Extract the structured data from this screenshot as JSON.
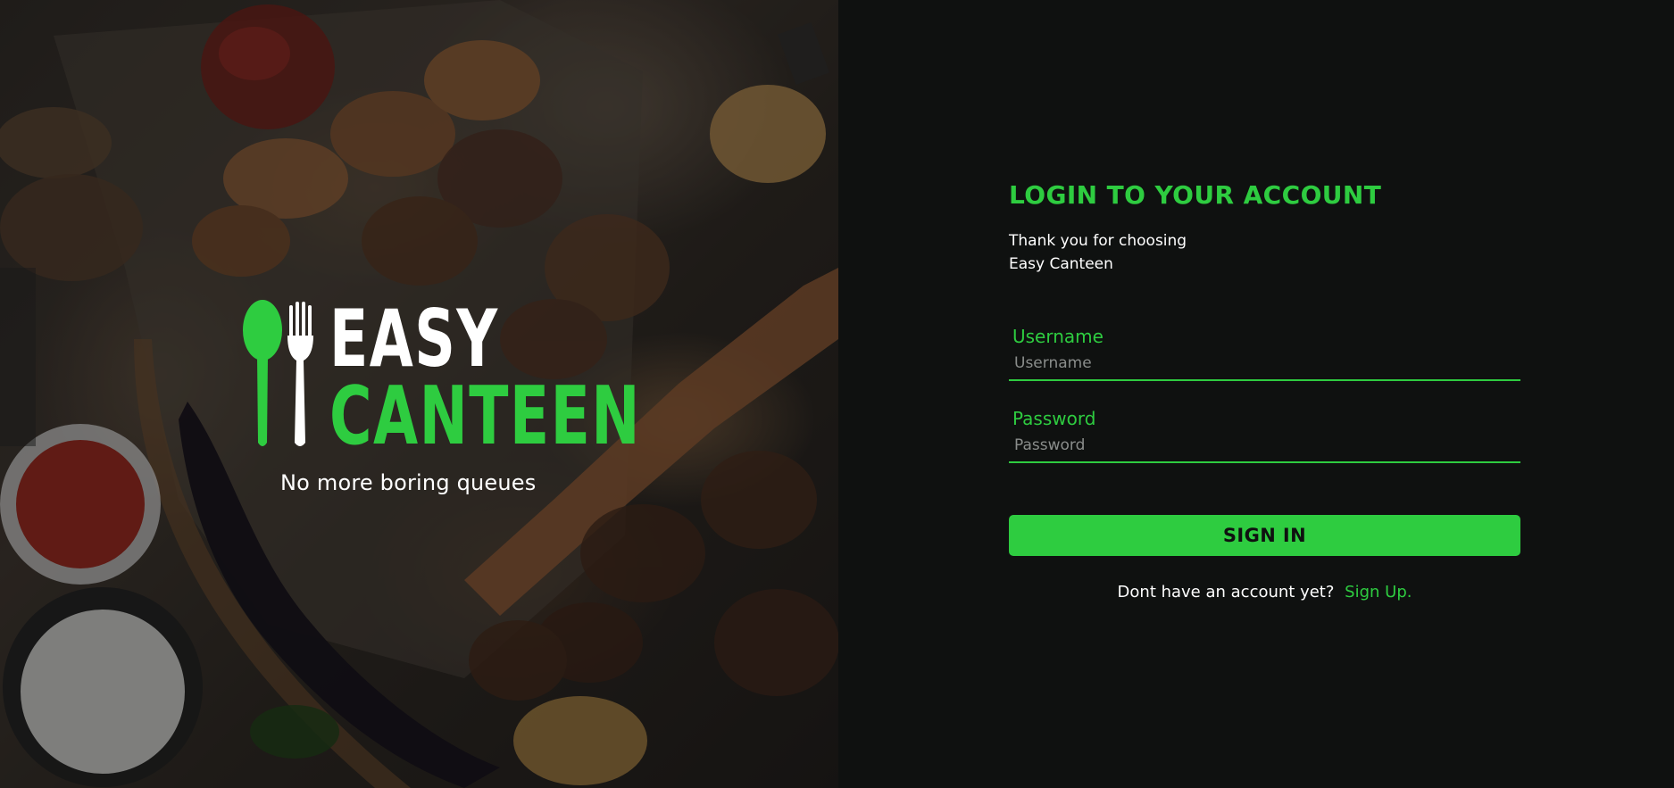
{
  "brand": {
    "name_line1": "EASY",
    "name_line2": "CANTEEN",
    "tagline": "No more boring queues",
    "logo_icons": [
      "spoon-icon",
      "fork-icon"
    ],
    "accent_color": "#2ecc40"
  },
  "login": {
    "title": "LOGIN TO YOUR ACCOUNT",
    "subtitle": "Thank you for choosing Easy Canteen",
    "username": {
      "label": "Username",
      "placeholder": "Username",
      "value": ""
    },
    "password": {
      "label": "Password",
      "placeholder": "Password",
      "value": ""
    },
    "submit_label": "SIGN IN",
    "signup_prompt": "Dont have an account yet?",
    "signup_link": "Sign Up."
  },
  "colors": {
    "panel_background": "#0f1110",
    "accent": "#2ecc40",
    "text": "#ffffff",
    "placeholder": "#8a8d8b"
  }
}
